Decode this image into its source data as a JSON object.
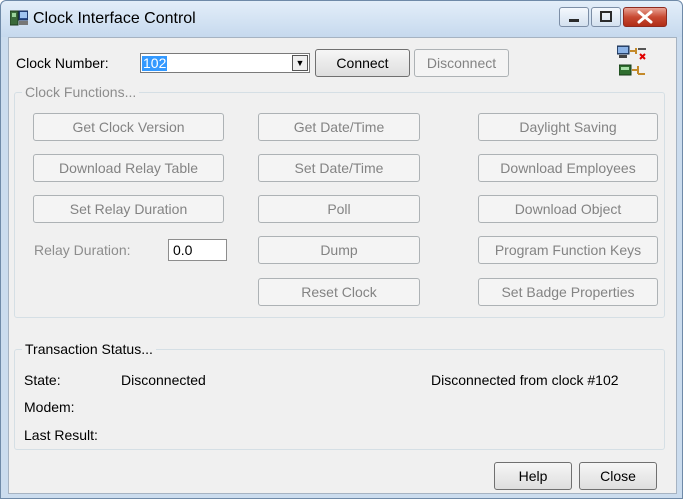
{
  "window": {
    "title": "Clock Interface Control",
    "controls": [
      "minimize",
      "maximize",
      "close"
    ]
  },
  "clock": {
    "number_label": "Clock Number:",
    "number_value": "102",
    "connect_label": "Connect",
    "disconnect_label": "Disconnect"
  },
  "functions": {
    "caption": "Clock Functions...",
    "buttons": {
      "get_clock_version": "Get Clock Version",
      "download_relay_table": "Download Relay Table",
      "set_relay_duration": "Set Relay Duration",
      "get_date_time": "Get Date/Time",
      "set_date_time": "Set Date/Time",
      "poll": "Poll",
      "dump": "Dump",
      "reset_clock": "Reset Clock",
      "daylight_saving": "Daylight Saving",
      "download_employees": "Download Employees",
      "download_object": "Download Object",
      "program_function_keys": "Program Function Keys",
      "set_badge_properties": "Set Badge Properties"
    },
    "relay_duration_label": "Relay Duration:",
    "relay_duration_value": "0.0"
  },
  "status": {
    "caption": "Transaction Status...",
    "state_label": "State:",
    "state_value": "Disconnected",
    "message": "Disconnected from clock #102",
    "modem_label": "Modem:",
    "last_result_label": "Last Result:"
  },
  "footer": {
    "help_label": "Help",
    "close_label": "Close"
  },
  "icons": {
    "app": "app-icon",
    "connection": "network-disconnected-icon",
    "device": "device-link-icon"
  },
  "colors": {
    "title_bar": "#cbdcee",
    "close_button": "#c84a33",
    "selection": "#3399ff",
    "disabled_text": "#838383"
  }
}
